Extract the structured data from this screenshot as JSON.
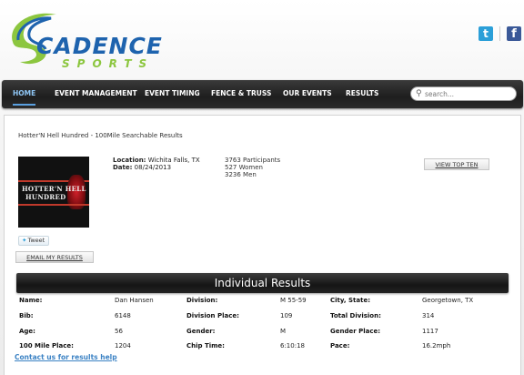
{
  "brand": {
    "name_main": "CADENCE",
    "name_sub": "SPORTS",
    "colors": {
      "blue": "#1e63ae",
      "green": "#8cc63f"
    }
  },
  "social": {
    "twitter_icon": "t",
    "facebook_icon": "f"
  },
  "nav": {
    "items": [
      {
        "label": "HOME",
        "active": true
      },
      {
        "label": "EVENT MANAGEMENT"
      },
      {
        "label": "EVENT TIMING"
      },
      {
        "label": "FENCE & TRUSS"
      },
      {
        "label": "OUR EVENTS"
      },
      {
        "label": "RESULTS"
      }
    ],
    "search_placeholder": "search..."
  },
  "event": {
    "title": "Hotter'N Hell Hundred - 100Mile Searchable Results",
    "logo_line1": "HOTTER'N HELL",
    "logo_line2": "HUNDRED",
    "location_label": "Location:",
    "location_value": "Wichita Falls, TX",
    "date_label": "Date:",
    "date_value": "08/24/2013",
    "participants": "3763 Participants",
    "women": "527 Women",
    "men": "3236 Men",
    "view_top_ten": "VIEW TOP TEN",
    "tweet": "Tweet",
    "email_results": "EMAIL MY RESULTS"
  },
  "results": {
    "header": "Individual Results",
    "rows": [
      [
        {
          "label": "Name:",
          "value": "Dan Hansen"
        },
        {
          "label": "Division:",
          "value": "M 55-59"
        },
        {
          "label": "City, State:",
          "value": "Georgetown, TX"
        }
      ],
      [
        {
          "label": "Bib:",
          "value": "6148"
        },
        {
          "label": "Division Place:",
          "value": "109"
        },
        {
          "label": "Total Division:",
          "value": "314"
        }
      ],
      [
        {
          "label": "Age:",
          "value": "56"
        },
        {
          "label": "Gender:",
          "value": "M"
        },
        {
          "label": "Gender Place:",
          "value": "1117"
        }
      ],
      [
        {
          "label": "100 Mile Place:",
          "value": "1204"
        },
        {
          "label": "Chip Time:",
          "value": "6:10:18"
        },
        {
          "label": "Pace:",
          "value": "16.2mph"
        }
      ]
    ],
    "contact_link": "Contact us for results help"
  }
}
